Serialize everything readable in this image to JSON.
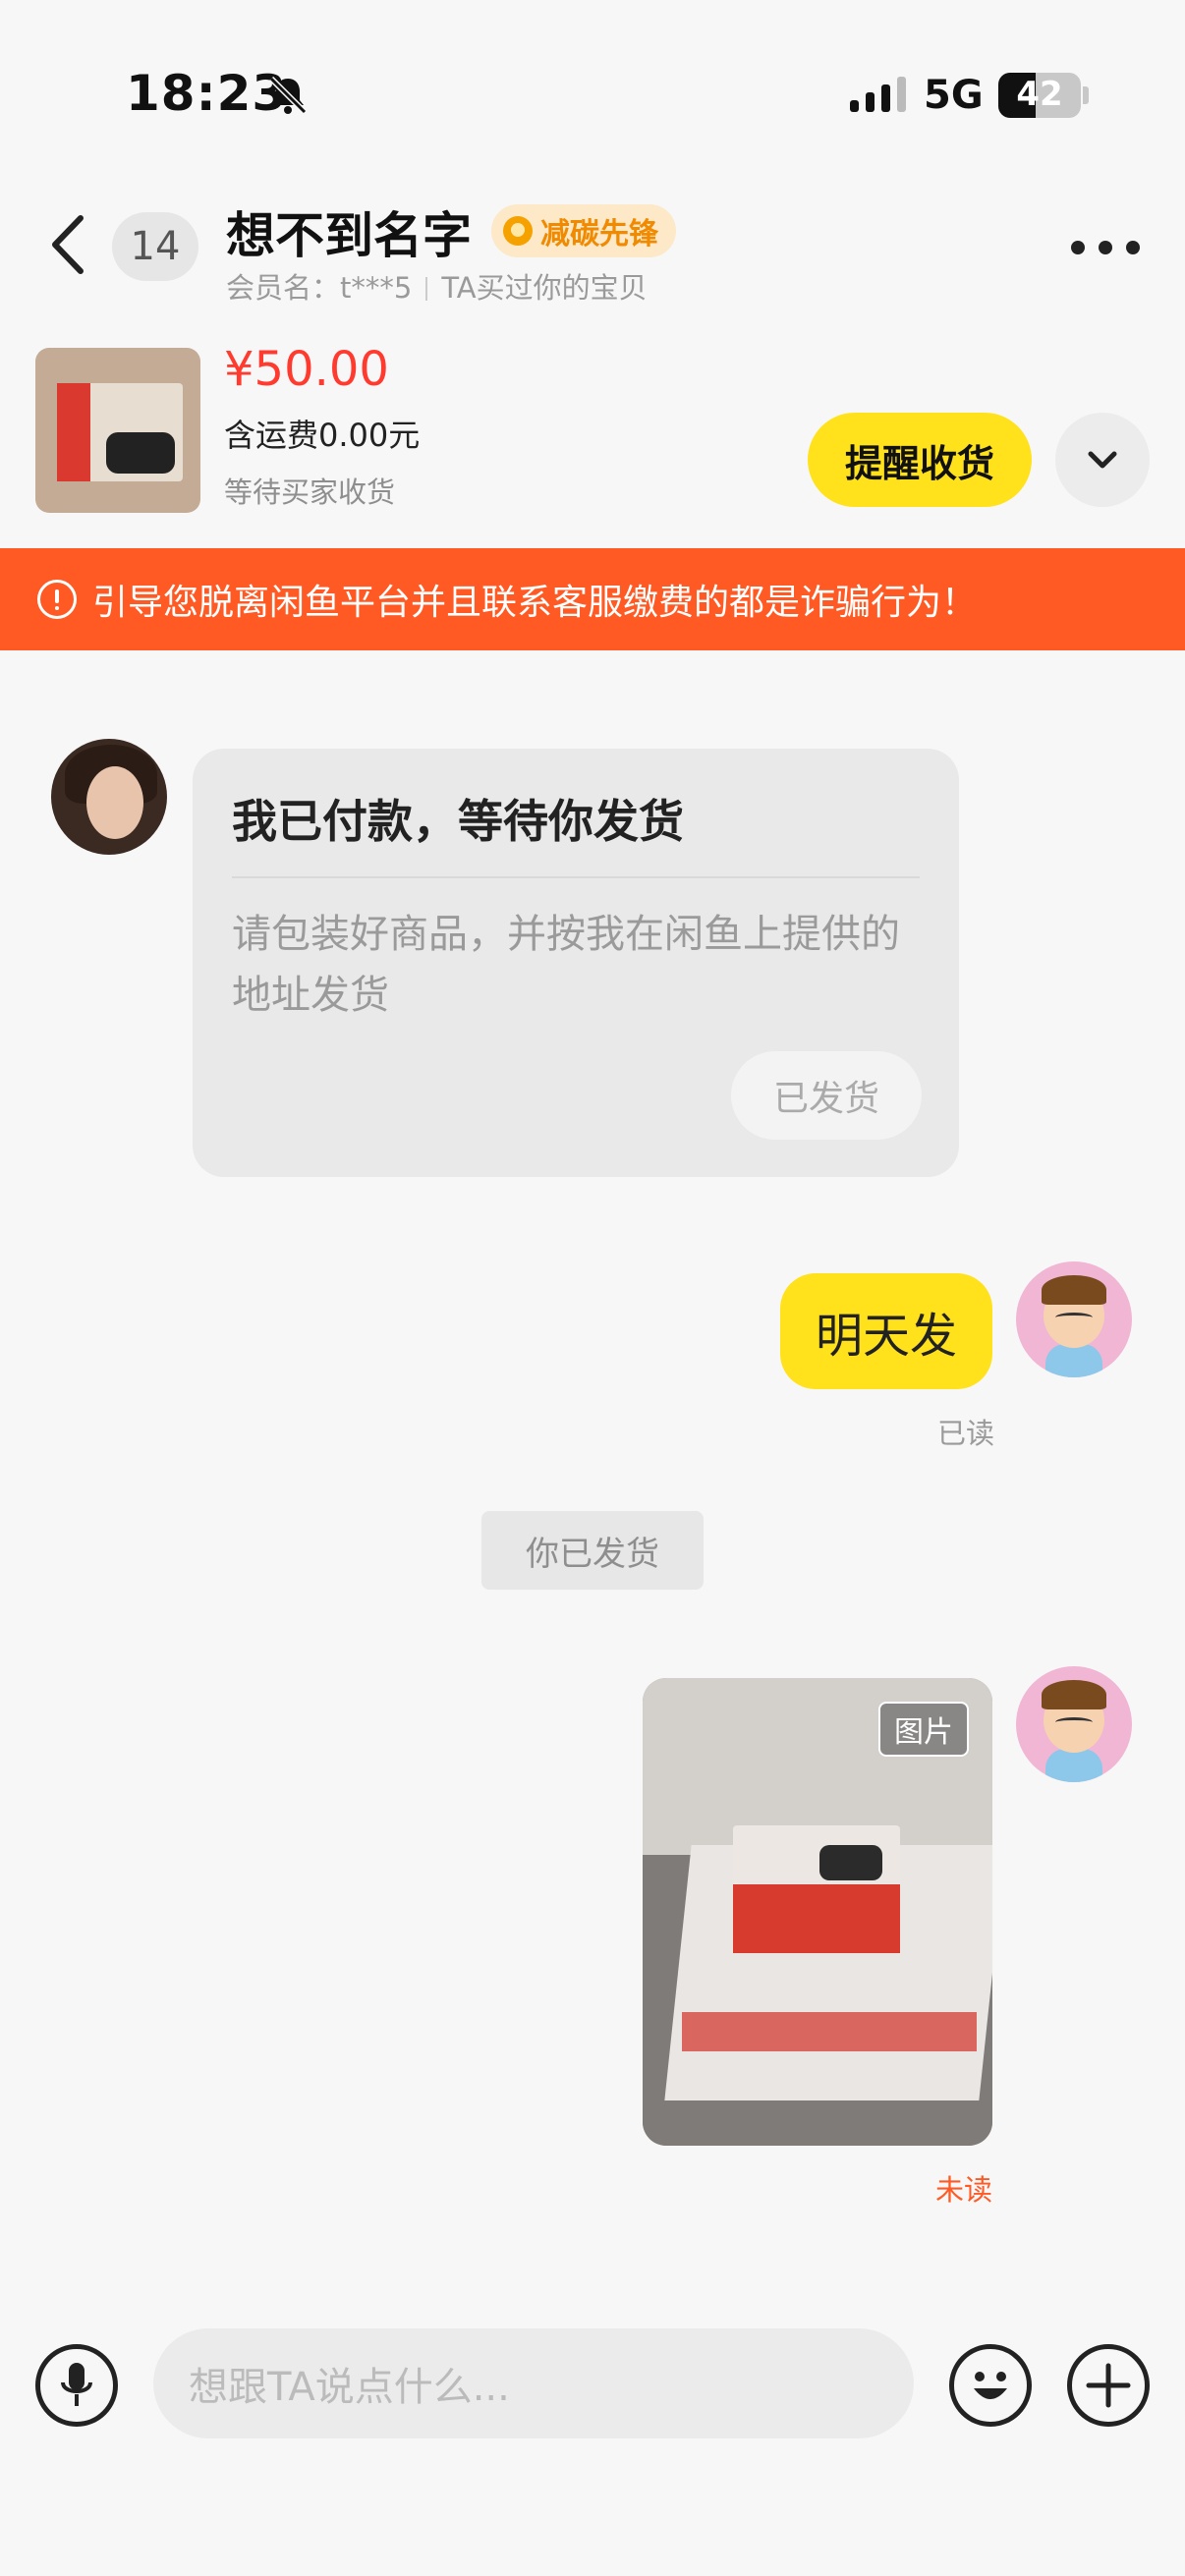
{
  "status_bar": {
    "time": "18:23",
    "network": "5G",
    "battery": "42"
  },
  "header": {
    "unread_count": "14",
    "name": "想不到名字",
    "badge": "减碳先锋",
    "member_label": "会员名：t***5",
    "relation": "TA买过你的宝贝"
  },
  "product": {
    "price": "¥50.00",
    "shipping": "含运费0.00元",
    "status": "等待买家收货",
    "remind_label": "提醒收货"
  },
  "warning": {
    "text": "引导您脱离闲鱼平台并且联系客服缴费的都是诈骗行为！"
  },
  "messages": {
    "card": {
      "title": "我已付款，等待你发货",
      "body": "请包装好商品，并按我在闲鱼上提供的地址发货",
      "button": "已发货"
    },
    "text_msg": {
      "text": "明天发",
      "status": "已读"
    },
    "system": {
      "text": "你已发货"
    },
    "image_msg": {
      "tag": "图片",
      "status": "未读"
    }
  },
  "input": {
    "placeholder": "想跟TA说点什么..."
  },
  "colors": {
    "accent_yellow": "#ffe21b",
    "warning_orange": "#ff5a24",
    "price_red": "#ff3b30"
  }
}
